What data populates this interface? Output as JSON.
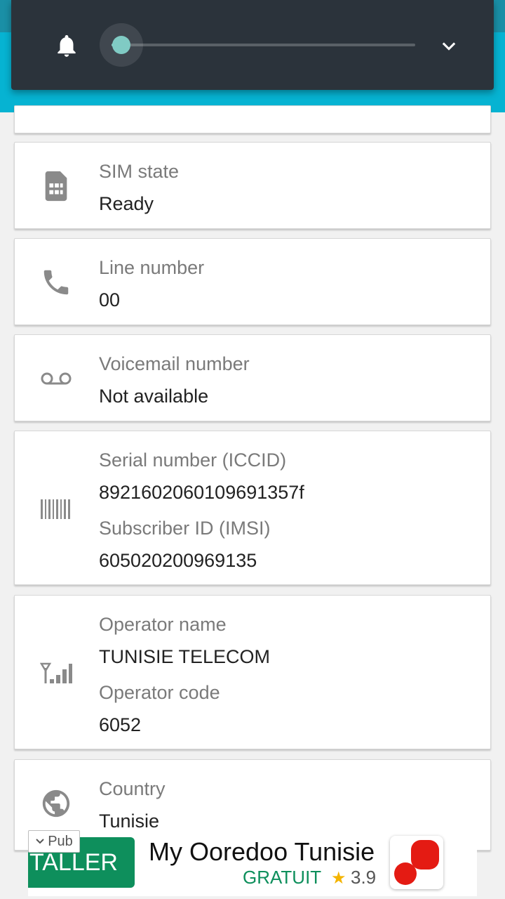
{
  "volume": {
    "level": 0.07,
    "accent": "#80cbc4",
    "icons": [
      "bell-icon",
      "chevron-down-icon"
    ]
  },
  "cards": [
    {
      "icon": "sim-card-icon",
      "label": "SIM state",
      "value": "Ready"
    },
    {
      "icon": "phone-icon",
      "label": "Line number",
      "value": "00"
    },
    {
      "icon": "voicemail-icon",
      "label": "Voicemail number",
      "value": "Not available"
    },
    {
      "icon": "barcode-icon",
      "label": "Serial number (ICCID)",
      "value": "8921602060109691357f",
      "label2": "Subscriber ID (IMSI)",
      "value2": "605020200969135"
    },
    {
      "icon": "signal-icon",
      "label": "Operator name",
      "value": "TUNISIE TELECOM",
      "label2": "Operator code",
      "value2": "6052"
    },
    {
      "icon": "globe-icon",
      "label": "Country",
      "value": "Tunisie"
    }
  ],
  "ad": {
    "badge": "Pub",
    "install_label": "TALLER",
    "title": "My Ooredoo Tunisie",
    "price": "GRATUIT",
    "rating": "3.9",
    "accent": "#0e8f5c",
    "logo_color": "#e41b13"
  },
  "colors": {
    "app_bar": "#06b3d2",
    "volume_panel": "#2b333b",
    "background": "#f1f1f1"
  }
}
